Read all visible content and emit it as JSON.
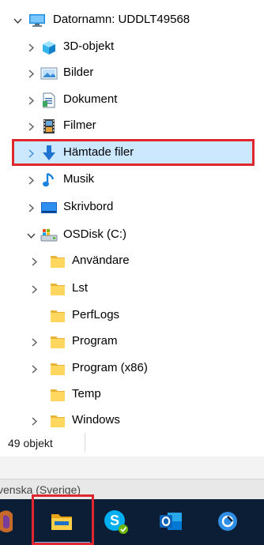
{
  "tree": {
    "items": [
      {
        "key": "pc",
        "label": "Datornamn: UDDLT49568",
        "icon": "computer-icon",
        "expanded": true,
        "level": 0,
        "hasChevron": true
      },
      {
        "key": "3d",
        "label": "3D-objekt",
        "icon": "3d-objects-icon",
        "expanded": false,
        "level": 1,
        "hasChevron": true
      },
      {
        "key": "bilder",
        "label": "Bilder",
        "icon": "pictures-icon",
        "expanded": false,
        "level": 1,
        "hasChevron": true
      },
      {
        "key": "dok",
        "label": "Dokument",
        "icon": "documents-icon",
        "expanded": false,
        "level": 1,
        "hasChevron": true
      },
      {
        "key": "filmer",
        "label": "Filmer",
        "icon": "videos-icon",
        "expanded": false,
        "level": 1,
        "hasChevron": true
      },
      {
        "key": "hamtade",
        "label": "Hämtade filer",
        "icon": "downloads-icon",
        "expanded": false,
        "level": 1,
        "hasChevron": true,
        "selected": true
      },
      {
        "key": "musik",
        "label": "Musik",
        "icon": "music-icon",
        "expanded": false,
        "level": 1,
        "hasChevron": true
      },
      {
        "key": "skriv",
        "label": "Skrivbord",
        "icon": "desktop-icon",
        "expanded": false,
        "level": 1,
        "hasChevron": true
      },
      {
        "key": "osdisk",
        "label": "OSDisk (C:)",
        "icon": "drive-icon",
        "expanded": true,
        "level": 1,
        "hasChevron": true
      },
      {
        "key": "anv",
        "label": "Användare",
        "icon": "folder-icon",
        "expanded": false,
        "level": 2,
        "hasChevron": true
      },
      {
        "key": "lst",
        "label": "Lst",
        "icon": "folder-icon",
        "expanded": false,
        "level": 2,
        "hasChevron": true
      },
      {
        "key": "perf",
        "label": "PerfLogs",
        "icon": "folder-icon",
        "expanded": false,
        "level": 2,
        "hasChevron": false
      },
      {
        "key": "prog",
        "label": "Program",
        "icon": "folder-icon",
        "expanded": false,
        "level": 2,
        "hasChevron": true
      },
      {
        "key": "prog86",
        "label": "Program (x86)",
        "icon": "folder-icon",
        "expanded": false,
        "level": 2,
        "hasChevron": true
      },
      {
        "key": "temp",
        "label": "Temp",
        "icon": "folder-icon",
        "expanded": false,
        "level": 2,
        "hasChevron": false
      },
      {
        "key": "win",
        "label": "Windows",
        "icon": "folder-icon",
        "expanded": false,
        "level": 2,
        "hasChevron": true
      }
    ]
  },
  "status": {
    "count": "49 objekt"
  },
  "langbar": {
    "text": "venska (Sverige)"
  },
  "taskbar": {
    "items": [
      {
        "name": "app-partial-icon",
        "active": false
      },
      {
        "name": "file-explorer-icon",
        "active": true
      },
      {
        "name": "skype-icon",
        "active": false
      },
      {
        "name": "outlook-icon",
        "active": false
      },
      {
        "name": "company-portal-icon",
        "active": false
      }
    ]
  },
  "colors": {
    "selection": "#cce8ff",
    "highlight_border": "#e0262f",
    "taskbar": "#0c1e35",
    "folder": "#ffd75e"
  }
}
